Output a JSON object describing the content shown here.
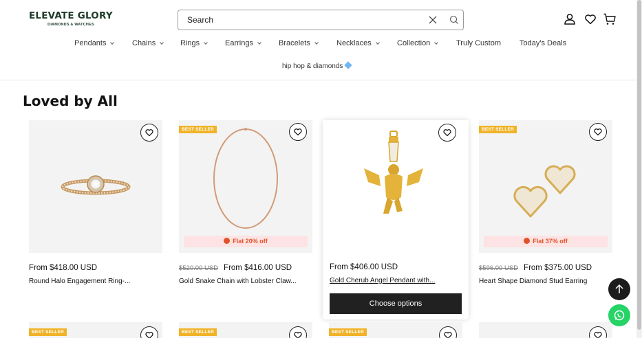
{
  "brand": {
    "name": "ELEVATE GLORY",
    "tagline": "DIAMONDS & WATCHES"
  },
  "search": {
    "placeholder": "Search"
  },
  "icons": {
    "account": "user-icon",
    "wishlist": "heart-icon",
    "cart": "cart-icon",
    "search": "search-icon",
    "clear": "close-icon"
  },
  "nav": {
    "items": [
      {
        "label": "Pendants",
        "dropdown": true
      },
      {
        "label": "Chains",
        "dropdown": true
      },
      {
        "label": "Rings",
        "dropdown": true
      },
      {
        "label": "Earrings",
        "dropdown": true
      },
      {
        "label": "Bracelets",
        "dropdown": true
      },
      {
        "label": "Necklaces",
        "dropdown": true
      },
      {
        "label": "Collection",
        "dropdown": true
      },
      {
        "label": "Truly Custom",
        "dropdown": false
      },
      {
        "label": "Today's Deals",
        "dropdown": false
      }
    ],
    "second_row": {
      "label": "hip hop & diamonds"
    }
  },
  "section": {
    "title": "Loved by All"
  },
  "products": [
    {
      "badge": "",
      "discount": "",
      "compare_price": "",
      "price": "From $418.00 USD",
      "title": "Round Halo Engagement Ring-..."
    },
    {
      "badge": "BEST SELLER",
      "discount": "Flat 20% off",
      "compare_price": "$520.00 USD",
      "price": "From $416.00 USD",
      "title": "Gold Snake Chain with Lobster Claw..."
    },
    {
      "badge": "",
      "discount": "",
      "compare_price": "",
      "price": "From $406.00 USD",
      "title": "Gold Cherub Angel Pendant with...",
      "button": "Choose options"
    },
    {
      "badge": "BEST SELLER",
      "discount": "Flat 37% off",
      "compare_price": "$596.00 USD",
      "price": "From $375.00 USD",
      "title": "Heart Shape Diamond Stud Earring"
    }
  ],
  "second_row_badges": [
    "BEST SELLER",
    "BEST SELLER",
    "BEST SELLER",
    ""
  ],
  "colors": {
    "brand": "#1e3b2b",
    "badge": "#f0b328",
    "discount_text": "#e0532a",
    "discount_bg": "#fde3e3",
    "button": "#212121",
    "whatsapp": "#25d366"
  }
}
